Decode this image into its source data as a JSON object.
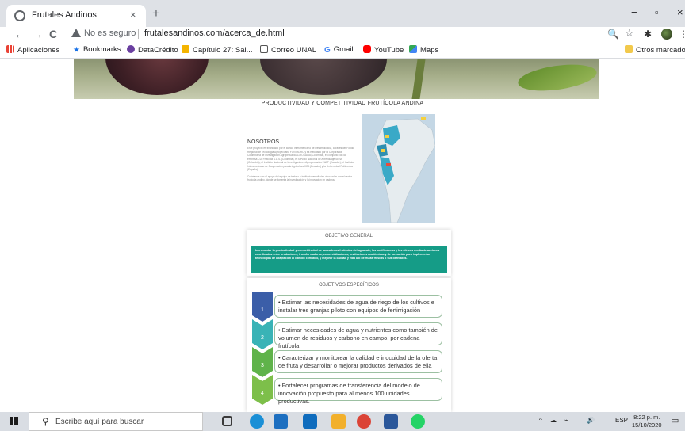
{
  "browser": {
    "tab_title": "Frutales Andinos",
    "tab_close": "×",
    "new_tab": "+",
    "win_min": "−",
    "win_max": "▫",
    "win_close": "×",
    "nav_back": "←",
    "nav_forward": "→",
    "nav_reload": "C",
    "security_text": "No es seguro",
    "url": "frutalesandinos.com/acerca_de.html",
    "zoom_icon": "🔍",
    "star_icon": "☆",
    "ext_icon": "✱",
    "menu_icon": "⋮",
    "bookmarks": [
      {
        "label": "Aplicaciones",
        "icon": "apps-grid",
        "color": "#e94235"
      },
      {
        "label": "Bookmarks",
        "icon": "star",
        "color": "#1a73e8"
      },
      {
        "label": "DataCrédito",
        "icon": "datacredito-logo",
        "color": "#6a3fa0"
      },
      {
        "label": "Capítulo 27: Sal...",
        "icon": "chapter-logo",
        "color": "#f4b400"
      },
      {
        "label": "Correo UNAL",
        "icon": "unal-logo",
        "color": "#555555"
      },
      {
        "label": "Gmail",
        "icon": "google-g",
        "color": "#4285f4"
      },
      {
        "label": "YouTube",
        "icon": "youtube-logo",
        "color": "#ff0000"
      },
      {
        "label": "Maps",
        "icon": "maps-logo",
        "color": "#34a853"
      }
    ],
    "other_bookmarks": "Otros marcadores"
  },
  "page": {
    "site_title": "PRODUCTIVIDAD Y COMPETITIVIDAD FRUTÍCOLA ANDINA",
    "about": {
      "title": "NOSOTROS",
      "paragraphs": [
        "Este proyecto es financiado por el Banco Interamericano de Desarrollo BID, a través del Fondo Regional de Tecnología Agropecuaria FONTAGRO y es ejecutado por la Corporación Colombiana de Investigación Agropecuaria AGROSAVIA (Colombia), en conjunto con la empresa CUI Frutícola S.A.S. (Colombia), el Servicio Nacional de Aprendizaje SENA (Colombia), el Instituto Nacional de Investigaciones Agropecuarias INIAP (Ecuador), el Instituto Interamericano de Cooperación para la Agricultura IICA (Ecuador) y la Universidad Politécnica (España).",
        "Cuéntanos con el apoyo del equipo de trabajo e instituciones aliadas vinculadas con el sector frutícola andino, donde se fomenta la investigación y la innovación en cadena."
      ]
    },
    "objetivo_general": {
      "title": "OBJETIVO GENERAL",
      "text": "Incrementar la productividad y competitividad de las cadenas frutícolas del aguacate, las pasifloráceas y los cítricos mediante acciones coordinadas entre productores, transformadores, comercializadores, instituciones académicas y de formación para implementar tecnologías de adaptación al cambio climático, y mejorar la calidad y vida útil de frutas frescas o sus derivados."
    },
    "objetivos_especificos": {
      "title": "OBJETIVOS ESPECÍFICOS",
      "items": [
        {
          "num": "1",
          "text": "• Estimar las necesidades de agua de riego de los cultivos e instalar tres granjas piloto con equipos de fertirrigación",
          "color": "#3b5ea8"
        },
        {
          "num": "2",
          "text": "• Estimar necesidades de agua y nutrientes como también de volumen de residuos y carbono en campo, por cadena frutícola",
          "color": "#39b3b6"
        },
        {
          "num": "3",
          "text": "• Caracterizar y monitorear la calidad e inocuidad de la oferta de fruta y desarrollar o mejorar productos derivados de ella",
          "color": "#5fb34a"
        },
        {
          "num": "4",
          "text": "• Fortalecer programas de transferencia del modelo de innovación propuesto para al menos 100 unidades productivas.",
          "color": "#7dbf4a"
        }
      ]
    }
  },
  "taskbar": {
    "search_placeholder": "Escribe aquí para buscar",
    "language": "ESP",
    "time": "8:22 p. m.",
    "date": "15/10/2020",
    "apps": [
      {
        "name": "task-view",
        "color": "#3a3a3a"
      },
      {
        "name": "edge",
        "color": "#1a8fd6"
      },
      {
        "name": "store",
        "color": "#1d6fc0"
      },
      {
        "name": "mail",
        "color": "#0f6cbd"
      },
      {
        "name": "file-explorer",
        "color": "#f2b02c"
      },
      {
        "name": "chrome",
        "color": "#db4437"
      },
      {
        "name": "word",
        "color": "#2b579a"
      },
      {
        "name": "whatsapp",
        "color": "#25d366"
      }
    ]
  }
}
